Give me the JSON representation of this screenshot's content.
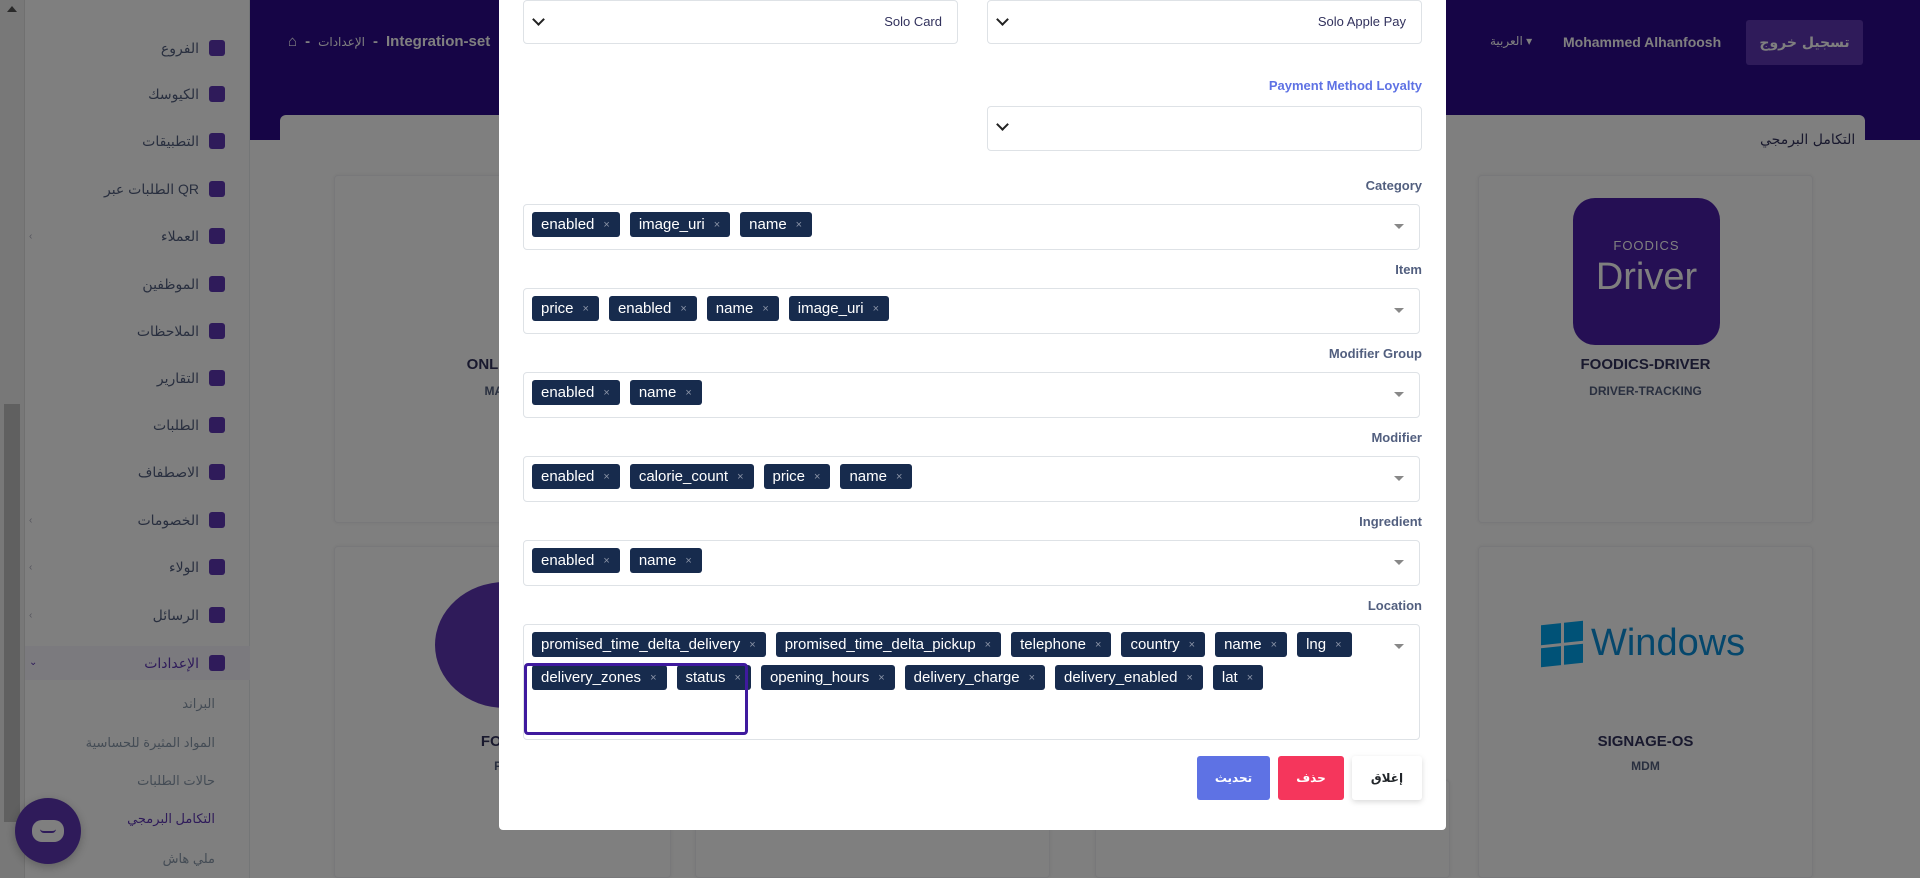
{
  "sidebar": {
    "items": [
      {
        "label": "الفروع",
        "icon": "map-icon"
      },
      {
        "label": "الكيوسك",
        "icon": "tablet-icon"
      },
      {
        "label": "التطبيقات",
        "icon": "mobile-icon"
      },
      {
        "label": "الطلبات عبر QR",
        "icon": "qr-code-icon"
      },
      {
        "label": "العملاء",
        "icon": "user-icon"
      },
      {
        "label": "الموظفين",
        "icon": "user-icon"
      },
      {
        "label": "الملاحظات",
        "icon": "comment-icon"
      },
      {
        "label": "التقارير",
        "icon": "flag-icon"
      },
      {
        "label": "الطلبات",
        "icon": "shopping-bag-icon"
      },
      {
        "label": "الاصطفاف",
        "icon": "car-icon"
      },
      {
        "label": "الخصومات",
        "icon": "percent-icon"
      },
      {
        "label": "الولاء",
        "icon": "medal-icon"
      },
      {
        "label": "الرسائل",
        "icon": "align-icon"
      },
      {
        "label": "الإعدادات",
        "icon": "gear-icon"
      }
    ],
    "sub_items": [
      "البراند",
      "المواد المثيرة للحساسية",
      "حالات الطلبات",
      "التكامل البرمجي",
      "ملي هاش"
    ]
  },
  "topbar": {
    "breadcrumb_settings": "الإعدادات",
    "breadcrumb_current": "Integration-set",
    "language": "العربية",
    "user_name": "Mohammed Alhanfoosh",
    "logout_label": "تسجيل خروج"
  },
  "background": {
    "section_title": "التكامل البرمجي",
    "tiles": {
      "online": {
        "name": "ONLINE-P",
        "sub": "MARK"
      },
      "driver": {
        "name": "FOODICS-DRIVER",
        "sub": "DRIVER-TRACKING",
        "logo_top": "FOODICS",
        "logo_main": "Driver"
      },
      "food": {
        "name": "FOOD",
        "sub": "PC"
      },
      "signage": {
        "name": "SIGNAGE-OS",
        "sub": "MDM",
        "logo_text": "Windows"
      }
    }
  },
  "modal": {
    "solo_card_value": "Solo Card",
    "solo_apple_pay_value": "Solo Apple Pay",
    "payment_method_loyalty_label": "Payment Method Loyalty",
    "fields": [
      {
        "label": "Category",
        "tags": [
          "enabled",
          "image_uri",
          "name"
        ]
      },
      {
        "label": "Item",
        "tags": [
          "price",
          "enabled",
          "name",
          "image_uri"
        ]
      },
      {
        "label": "Modifier Group",
        "tags": [
          "enabled",
          "name"
        ]
      },
      {
        "label": "Modifier",
        "tags": [
          "enabled",
          "calorie_count",
          "price",
          "name"
        ]
      },
      {
        "label": "Ingredient",
        "tags": [
          "enabled",
          "name"
        ]
      },
      {
        "label": "Location",
        "tags": [
          "promised_time_delta_delivery",
          "promised_time_delta_pickup",
          "telephone",
          "country",
          "name",
          "lng",
          "delivery_zones",
          "status",
          "opening_hours",
          "delivery_charge",
          "delivery_enabled",
          "lat"
        ]
      }
    ],
    "buttons": {
      "update": "تحديث",
      "delete": "حذف",
      "close": "إغلاق"
    }
  },
  "colors": {
    "brand_purple": "#2d0a8c",
    "accent": "#5e37b5",
    "tag_bg": "#172b4d",
    "update": "#5e72e4",
    "delete": "#f5365c"
  }
}
